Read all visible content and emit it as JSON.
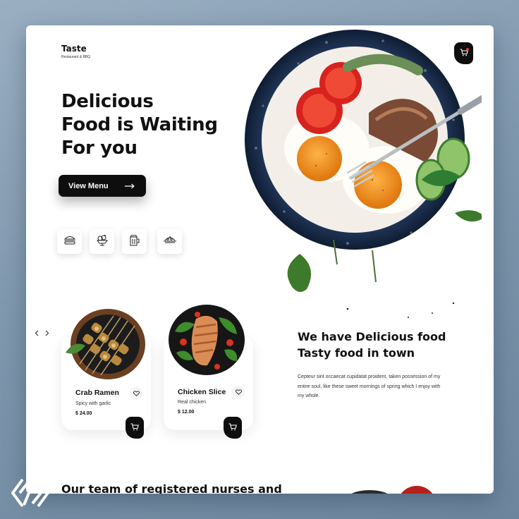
{
  "brand": {
    "name": "Taste",
    "tagline": "Restaurant & BBQ"
  },
  "hero": {
    "title": "Delicious\nFood is Waiting\nFor you",
    "cta_label": "View Menu"
  },
  "categories": [
    {
      "icon": "burger-icon"
    },
    {
      "icon": "ice-cream-icon"
    },
    {
      "icon": "beer-mug-icon"
    },
    {
      "icon": "food-platter-icon"
    }
  ],
  "menu_cards": [
    {
      "title": "Crab Ramen",
      "subtitle": "Spicy with garlic",
      "price": "$ 24.00",
      "image": "skewers-plate"
    },
    {
      "title": "Chicken Slice",
      "subtitle": "Real chicken",
      "price": "$ 12.00",
      "image": "chicken-salad-plate"
    }
  ],
  "promo": {
    "title": "We have Delicious food\nTasty food in town",
    "text": "Cepteur sint occaecat cupidatat proident, taken possession of my entire soul, like these sweet mornings of spring which I enjoy with my whole."
  },
  "team": {
    "heading": "Our team of registered nurses and"
  },
  "colors": {
    "accent": "#0e0e0e",
    "notification": "#e53935",
    "background": "#8aa1b6"
  }
}
